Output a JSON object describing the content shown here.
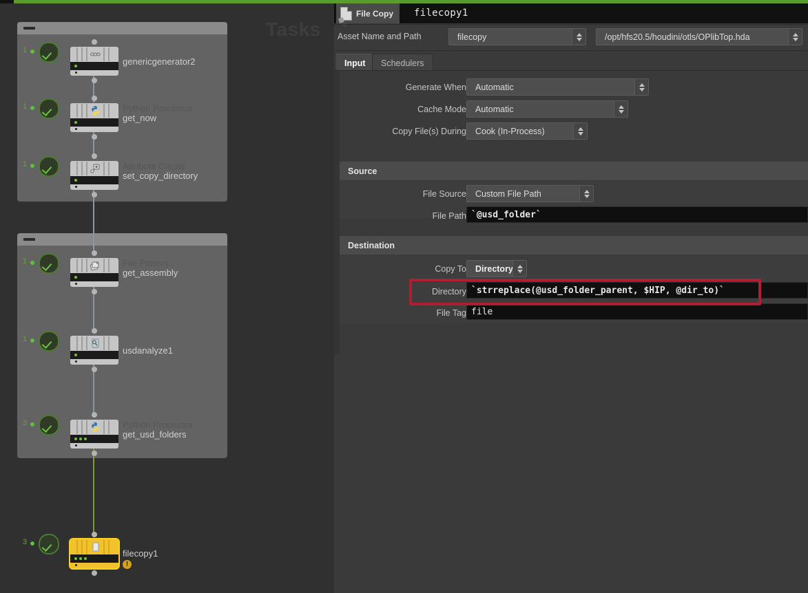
{
  "window": {
    "accent_top_bar_color": "#5b9b2e",
    "background_color": "#303030"
  },
  "network_editor": {
    "watermark": "Tasks",
    "groups": [
      {
        "name": "group-top"
      },
      {
        "name": "group-middle"
      }
    ],
    "nodes": [
      {
        "name": "genericgenerator2",
        "type_label": "",
        "icon": "generic-generator-icon",
        "work_items": "1",
        "selected": false,
        "warning": false
      },
      {
        "name": "get_now",
        "type_label": "Python Processor",
        "icon": "python-icon",
        "work_items": "1",
        "selected": false,
        "warning": false
      },
      {
        "name": "set_copy_directory",
        "type_label": "Attribute Create",
        "icon": "attribute-create-icon",
        "work_items": "1",
        "selected": false,
        "warning": false
      },
      {
        "name": "get_assembly",
        "type_label": "File Pattern",
        "icon": "file-pattern-icon",
        "work_items": "1",
        "selected": false,
        "warning": false
      },
      {
        "name": "usdanalyze1",
        "type_label": "",
        "icon": "usd-analyze-icon",
        "work_items": "1",
        "selected": false,
        "warning": false
      },
      {
        "name": "get_usd_folders",
        "type_label": "Python Processor",
        "icon": "python-icon",
        "work_items": "3",
        "selected": false,
        "warning": false
      },
      {
        "name": "filecopy1",
        "type_label": "",
        "icon": "file-copy-icon",
        "work_items": "3",
        "selected": true,
        "warning": true,
        "warning_glyph": "!"
      }
    ]
  },
  "parameter_panel": {
    "node_type_label": "File Copy",
    "node_name": "filecopy1",
    "asset_row": {
      "label": "Asset Name and Path",
      "asset_name": "filecopy",
      "asset_path": "/opt/hfs20.5/houdini/otls/OPlibTop.hda"
    },
    "tabs": [
      {
        "label": "Input",
        "active": true
      },
      {
        "label": "Schedulers",
        "active": false
      }
    ],
    "top_params": [
      {
        "label": "Generate When",
        "value": "Automatic",
        "control": "menu"
      },
      {
        "label": "Cache Mode",
        "value": "Automatic",
        "control": "menu"
      },
      {
        "label": "Copy File(s) During",
        "value": "Cook (In-Process)",
        "control": "menu"
      }
    ],
    "source_section": {
      "title": "Source",
      "params": [
        {
          "label": "File Source",
          "value": "Custom File Path",
          "control": "menu"
        },
        {
          "label": "File Path",
          "value": "`@usd_folder`",
          "control": "text"
        }
      ]
    },
    "destination_section": {
      "title": "Destination",
      "params": [
        {
          "label": "Copy To",
          "value": "Directory",
          "control": "menu"
        },
        {
          "label": "Directory",
          "value": "`strreplace(@usd_folder_parent, $HIP, @dir_to)`",
          "control": "text",
          "highlighted": true
        },
        {
          "label": "File Tag",
          "value": "file",
          "control": "text"
        }
      ]
    },
    "highlight": {
      "color": "#b01e34"
    }
  }
}
